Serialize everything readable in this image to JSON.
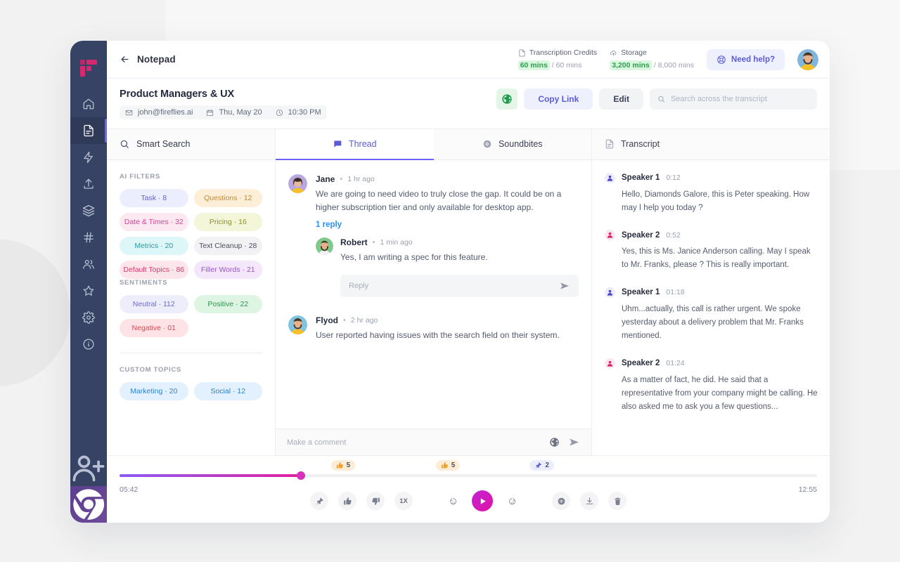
{
  "app": {
    "logo_name": "fireflies-logo",
    "sidebar_items": [
      {
        "icon": "home-icon",
        "label": "Home",
        "active": false
      },
      {
        "icon": "document-icon",
        "label": "Notepad",
        "active": true
      },
      {
        "icon": "lightning-icon",
        "label": "Automations",
        "active": false
      },
      {
        "icon": "upload-icon",
        "label": "Upload",
        "active": false
      },
      {
        "icon": "layers-icon",
        "label": "Library",
        "active": false
      },
      {
        "icon": "hash-icon",
        "label": "Channels",
        "active": false
      },
      {
        "icon": "users-icon",
        "label": "Teams",
        "active": false
      },
      {
        "icon": "star-icon",
        "label": "Starred",
        "active": false
      },
      {
        "icon": "gear-icon",
        "label": "Settings",
        "active": false
      },
      {
        "icon": "info-icon",
        "label": "Info",
        "active": false
      }
    ],
    "sidebar_bottom": [
      {
        "icon": "add-user-icon",
        "label": "Invite"
      },
      {
        "icon": "chrome-icon",
        "label": "Chrome Extension"
      }
    ]
  },
  "topbar": {
    "back_icon": "arrow-left-icon",
    "back_label": "Notepad",
    "credits": {
      "icon": "document-icon",
      "title": "Transcription Credits",
      "used": "60 mins",
      "total": "/ 60 mins"
    },
    "storage": {
      "icon": "cloud-upload-icon",
      "title": "Storage",
      "used": "3,200 mins",
      "total": "/ 8,000 mins"
    },
    "help_label": "Need help?",
    "help_icon": "lifebuoy-icon",
    "avatar": "user-avatar"
  },
  "meeting": {
    "title": "Product Managers & UX",
    "email": "john@fireflies.ai",
    "date": "Thu, May 20",
    "time": "10:30 PM",
    "globe_icon": "globe-icon",
    "copy_link_label": "Copy Link",
    "edit_label": "Edit",
    "search_placeholder": "Search across the transcript",
    "search_value": ""
  },
  "left_panel": {
    "smart_search_label": "Smart Search",
    "groups": [
      {
        "title": "AI FILTERS",
        "chips": [
          {
            "label": "Task · 8",
            "bg": "#eceefd",
            "fg": "#5f5fd1"
          },
          {
            "label": "Questions · 12",
            "bg": "#fdeed8",
            "fg": "#c98a2b"
          },
          {
            "label": "Date & Times · 32",
            "bg": "#fce8f1",
            "fg": "#d4459a"
          },
          {
            "label": "Pricing · 16",
            "bg": "#f4f6d9",
            "fg": "#8a8f2d"
          },
          {
            "label": "Metrics · 20",
            "bg": "#ddf6f7",
            "fg": "#2a9aa4"
          },
          {
            "label": "Text Cleanup · 28",
            "bg": "#f2f2f4",
            "fg": "#4a4f60"
          },
          {
            "label": "Default Topics · 86",
            "bg": "#fde5ec",
            "fg": "#e0366e"
          },
          {
            "label": "Filler Words · 21",
            "bg": "#f4e6fb",
            "fg": "#9a53c9"
          }
        ]
      },
      {
        "title": "SENTIMENTS",
        "chips": [
          {
            "label": "Neutral · 112",
            "bg": "#ededfb",
            "fg": "#6a6ad4"
          },
          {
            "label": "Positive · 22",
            "bg": "#def5e3",
            "fg": "#2f9350"
          },
          {
            "label": "Negative · 01",
            "bg": "#fde3e6",
            "fg": "#e0454f"
          }
        ]
      },
      {
        "title": "CUSTOM TOPICS",
        "chips": [
          {
            "label": "Marketing · 20",
            "bg": "#e2f1fd",
            "fg": "#2f83c9"
          },
          {
            "label": "Social · 12",
            "bg": "#e2f1fd",
            "fg": "#2f83c9"
          }
        ]
      }
    ]
  },
  "tabs": [
    {
      "label": "Thread",
      "icon": "chat-icon",
      "active": true
    },
    {
      "label": "Soundbites",
      "icon": "soundwave-icon",
      "active": false
    }
  ],
  "thread": {
    "posts": [
      {
        "author": "Jane",
        "time": "1 hr ago",
        "text": "We are going to need video to truly close the gap. It could be on a higher subscription tier and only available for desktop app.",
        "reply_link": "1 reply",
        "reply": {
          "author": "Robert",
          "time": "1 min ago",
          "text": "Yes, I am writing a spec for this feature."
        },
        "reply_placeholder": "Reply"
      },
      {
        "author": "Flyod",
        "time": "2 hr ago",
        "text": "User reported having issues with the search field on their system."
      }
    ],
    "comment_placeholder": "Make a comment"
  },
  "transcript": {
    "header_label": "Transcript",
    "header_icon": "document-icon",
    "blocks": [
      {
        "speaker": "Speaker 1",
        "time": "0:12",
        "side": "s1",
        "text": "Hello, Diamonds Galore, this is Peter speaking. How may I help you today ?"
      },
      {
        "speaker": "Speaker 2",
        "time": "0:52",
        "side": "s2",
        "text": "Yes, this is Ms. Janice Anderson calling. May I speak to Mr. Franks, please ? This is really important."
      },
      {
        "speaker": "Speaker 1",
        "time": "01:18",
        "side": "s1",
        "text": "Uhm...actually, this call is rather urgent. We spoke yesterday about a delivery problem that Mr. Franks mentioned."
      },
      {
        "speaker": "Speaker 2",
        "time": "01:24",
        "side": "s2",
        "text": "As a matter of fact, he did. He said that a representative from your company might be calling. He also asked me to ask you a few questions..."
      }
    ]
  },
  "player": {
    "current_time": "05:42",
    "duration": "12:55",
    "progress_percent": 26,
    "reactions": [
      {
        "icon": "thumbs-up-icon",
        "count": "5",
        "left_percent": 31,
        "bg": "#fdedd6"
      },
      {
        "icon": "thumbs-up-icon",
        "count": "5",
        "left_percent": 45.5,
        "bg": "#fdedd6"
      },
      {
        "icon": "pin-icon",
        "count": "2",
        "left_percent": 58.5,
        "bg": "#eceefd"
      }
    ],
    "controls": [
      {
        "icon": "pin-icon",
        "name": "pin-button"
      },
      {
        "icon": "thumbs-up-icon",
        "name": "thumbs-up-button"
      },
      {
        "icon": "thumbs-down-icon",
        "name": "thumbs-down-button"
      },
      {
        "icon": "speed-icon",
        "name": "playback-speed-button",
        "label": "1X"
      },
      {
        "icon": "rewind-15-icon",
        "name": "rewind-button",
        "label": "15"
      },
      {
        "icon": "play-icon",
        "name": "play-button"
      },
      {
        "icon": "forward-15-icon",
        "name": "forward-button",
        "label": "15"
      },
      {
        "icon": "soundwave-icon",
        "name": "soundbite-button"
      },
      {
        "icon": "download-icon",
        "name": "download-button"
      },
      {
        "icon": "trash-icon",
        "name": "delete-button"
      }
    ]
  },
  "colors": {
    "sidebar_bg": "#364364",
    "accent": "#6c63ff",
    "accent_soft": "#eef0fe",
    "play_gradient_start": "#c026d3",
    "play_gradient_end": "#e212a4",
    "seek_start": "#8b5cf6",
    "seek_end": "#e1219e"
  }
}
